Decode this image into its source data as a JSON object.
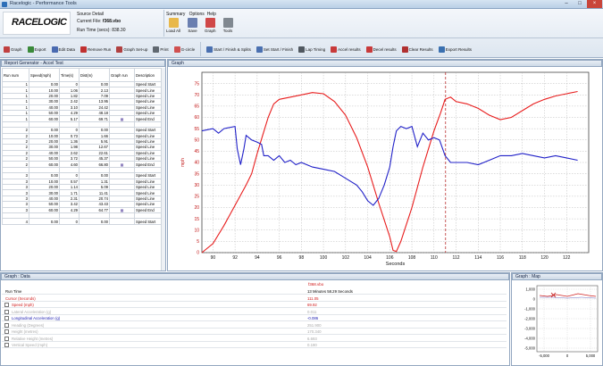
{
  "window": {
    "title": "Racelogic - Performance Tools",
    "minimize": "–",
    "maximize": "□",
    "close": "×"
  },
  "logo": {
    "text": "RACELOGIC"
  },
  "source": {
    "title": "Source Detail",
    "file_label": "Current File:",
    "file_value": "f368.vbo",
    "run_label": "Run Time (secs):",
    "run_value": "838.30"
  },
  "menu": [
    "Summary",
    "Options",
    "Help"
  ],
  "big_buttons": [
    {
      "label": "Load All",
      "icon": "folder-icon",
      "color": "#e8b84a"
    },
    {
      "label": "Save",
      "icon": "save-icon",
      "color": "#6a7fb0"
    },
    {
      "label": "Graph",
      "icon": "graph-icon",
      "color": "#d04848"
    },
    {
      "label": "Tools",
      "icon": "tools-icon",
      "color": "#808890"
    }
  ],
  "toolbar_row1": [
    {
      "label": "Graph",
      "icon": "graph-small-icon",
      "color": "#c04040"
    },
    {
      "label": "Export",
      "icon": "export-icon",
      "color": "#3a8a3a"
    },
    {
      "label": "Edit Data",
      "icon": "edit-icon",
      "color": "#4a6ab0"
    },
    {
      "label": "Remove Run",
      "icon": "remove-icon",
      "color": "#c03030"
    },
    {
      "label": "Graph Set-up",
      "icon": "graph-setup-icon",
      "color": "#b04040"
    },
    {
      "label": "Print",
      "icon": "print-icon",
      "color": "#606870"
    },
    {
      "label": "G-circle",
      "icon": "g-circle-icon",
      "color": "#d05050"
    }
  ],
  "toolbar_row2": [
    {
      "label": "Start / Finish & Splits",
      "icon": "splits-icon",
      "color": "#4a70b0"
    },
    {
      "label": "Set Start / Finish",
      "icon": "set-start-icon",
      "color": "#4a70b0"
    },
    {
      "label": "Lap Timing",
      "icon": "lap-timing-icon",
      "color": "#505860"
    },
    {
      "label": "Accel results",
      "icon": "accel-icon",
      "color": "#c83a3a"
    },
    {
      "label": "Decel results",
      "icon": "decel-icon",
      "color": "#c83a3a"
    },
    {
      "label": "Clear Results",
      "icon": "clear-results-icon",
      "color": "#b03030"
    },
    {
      "label": "Export Results",
      "icon": "export-results-icon",
      "color": "#3a70b0"
    }
  ],
  "report": {
    "title": "Report Generator - Accel Test",
    "headers": [
      "Run num",
      "Speed(mph)",
      "Time(s)",
      "Dist(m)",
      "Graph run",
      "Description"
    ],
    "rows": [
      [
        "1",
        "0.00",
        "0",
        "0.00",
        "",
        "Speed Start"
      ],
      [
        "1",
        "10.00",
        "1.06",
        "2.13",
        "",
        "Speed Line"
      ],
      [
        "1",
        "20.00",
        "1.82",
        "7.09",
        "",
        "Speed Line"
      ],
      [
        "1",
        "30.00",
        "2.42",
        "13.95",
        "",
        "Speed Line"
      ],
      [
        "1",
        "40.00",
        "3.10",
        "24.42",
        "",
        "Speed Line"
      ],
      [
        "1",
        "50.00",
        "4.29",
        "48.18",
        "",
        "Speed Line"
      ],
      [
        "1",
        "60.00",
        "5.17",
        "69.71",
        "icon",
        "Speed End"
      ],
      [
        "",
        "",
        "",
        "",
        "",
        ""
      ],
      [
        "2",
        "0.00",
        "0",
        "0.00",
        "",
        "Speed Start"
      ],
      [
        "2",
        "10.00",
        "0.73",
        "1.66",
        "",
        "Speed Line"
      ],
      [
        "2",
        "20.00",
        "1.36",
        "5.91",
        "",
        "Speed Line"
      ],
      [
        "2",
        "30.00",
        "1.98",
        "12.67",
        "",
        "Speed Line"
      ],
      [
        "2",
        "40.00",
        "2.62",
        "22.61",
        "",
        "Speed Line"
      ],
      [
        "2",
        "50.00",
        "3.72",
        "45.37",
        "",
        "Speed Line"
      ],
      [
        "2",
        "60.00",
        "4.60",
        "66.80",
        "icon",
        "Speed End"
      ],
      [
        "",
        "",
        "",
        "",
        "",
        ""
      ],
      [
        "3",
        "0.00",
        "0",
        "0.00",
        "",
        "Speed Start"
      ],
      [
        "3",
        "10.00",
        "0.57",
        "1.31",
        "",
        "Speed Line"
      ],
      [
        "3",
        "20.00",
        "1.14",
        "5.09",
        "",
        "Speed Line"
      ],
      [
        "3",
        "30.00",
        "1.71",
        "11.41",
        "",
        "Speed Line"
      ],
      [
        "3",
        "40.00",
        "2.31",
        "20.74",
        "",
        "Speed Line"
      ],
      [
        "3",
        "50.00",
        "3.42",
        "43.43",
        "",
        "Speed Line"
      ],
      [
        "3",
        "60.00",
        "4.29",
        "64.77",
        "icon",
        "Speed End"
      ],
      [
        "",
        "",
        "",
        "",
        "",
        ""
      ],
      [
        "4",
        "0.00",
        "0",
        "0.00",
        "",
        "Speed Start"
      ]
    ]
  },
  "graph": {
    "title": "Graph"
  },
  "chart_data": {
    "type": "line",
    "xlabel": "Seconds",
    "ylabel": "mph",
    "xlim": [
      89,
      124
    ],
    "ylim": [
      0,
      80
    ],
    "xticks": [
      90,
      92,
      94,
      96,
      98,
      100,
      102,
      104,
      106,
      108,
      110,
      112,
      114,
      116,
      118,
      120,
      122
    ],
    "yticks": [
      0,
      5,
      10,
      15,
      20,
      25,
      30,
      35,
      40,
      45,
      50,
      55,
      60,
      65,
      70,
      75
    ],
    "cursor_x": 111.05,
    "grid": true,
    "series": [
      {
        "color": "#e81c1c",
        "points": [
          [
            89,
            0
          ],
          [
            90,
            4
          ],
          [
            91,
            12
          ],
          [
            92,
            21
          ],
          [
            93,
            30
          ],
          [
            93.5,
            35
          ],
          [
            94,
            44
          ],
          [
            94.5,
            52
          ],
          [
            95,
            60
          ],
          [
            95.5,
            66
          ],
          [
            96,
            68
          ],
          [
            97,
            69
          ],
          [
            98,
            70
          ],
          [
            99,
            71
          ],
          [
            100,
            70.5
          ],
          [
            101,
            67
          ],
          [
            102,
            61
          ],
          [
            103,
            51
          ],
          [
            104,
            38
          ],
          [
            105,
            22
          ],
          [
            106,
            7
          ],
          [
            106.3,
            1
          ],
          [
            106.6,
            0.5
          ],
          [
            107,
            5
          ],
          [
            108,
            20
          ],
          [
            109,
            38
          ],
          [
            110,
            54
          ],
          [
            110.6,
            62
          ],
          [
            111,
            68
          ],
          [
            111.5,
            69
          ],
          [
            112,
            67
          ],
          [
            113,
            66
          ],
          [
            114,
            64
          ],
          [
            115,
            61
          ],
          [
            116,
            59
          ],
          [
            117,
            60
          ],
          [
            118,
            63
          ],
          [
            119,
            66
          ],
          [
            120,
            68
          ],
          [
            121,
            69.5
          ],
          [
            122,
            70.5
          ],
          [
            123,
            71.5
          ]
        ]
      },
      {
        "color": "#2020c8",
        "points": [
          [
            89,
            54
          ],
          [
            90,
            55
          ],
          [
            90.5,
            53
          ],
          [
            91,
            55
          ],
          [
            92,
            56
          ],
          [
            92.2,
            46
          ],
          [
            92.5,
            39
          ],
          [
            92.8,
            46
          ],
          [
            93,
            52
          ],
          [
            93.5,
            50
          ],
          [
            94,
            49
          ],
          [
            94.4,
            48
          ],
          [
            94.6,
            43
          ],
          [
            95,
            43
          ],
          [
            95.5,
            41
          ],
          [
            96,
            43
          ],
          [
            96.5,
            40
          ],
          [
            97,
            41
          ],
          [
            97.5,
            39
          ],
          [
            98,
            40
          ],
          [
            99,
            38
          ],
          [
            100,
            37
          ],
          [
            101,
            36
          ],
          [
            102,
            33
          ],
          [
            103,
            30
          ],
          [
            103.5,
            27
          ],
          [
            104,
            23
          ],
          [
            104.5,
            21
          ],
          [
            105,
            24
          ],
          [
            105.5,
            30
          ],
          [
            106,
            38
          ],
          [
            106.3,
            47
          ],
          [
            106.6,
            54
          ],
          [
            107,
            56
          ],
          [
            107.5,
            55
          ],
          [
            108,
            56
          ],
          [
            108.5,
            47
          ],
          [
            109,
            53
          ],
          [
            109.5,
            50
          ],
          [
            110,
            51
          ],
          [
            110.5,
            50
          ],
          [
            111,
            43
          ],
          [
            111.5,
            40
          ],
          [
            112,
            40
          ],
          [
            113,
            40
          ],
          [
            114,
            39
          ],
          [
            115,
            41
          ],
          [
            116,
            43
          ],
          [
            117,
            43
          ],
          [
            118,
            44
          ],
          [
            119,
            43
          ],
          [
            120,
            42
          ],
          [
            121,
            43
          ],
          [
            122,
            42
          ],
          [
            123,
            41
          ]
        ]
      }
    ]
  },
  "graph_data": {
    "title": "Graph : Data",
    "file": "f368.vbo",
    "rows": [
      {
        "label": "Run Time",
        "value": "13 Minutes 58.29 Seconds",
        "style": "normal",
        "check": false
      },
      {
        "label": "Cursor (Seconds)",
        "value": "111.05",
        "style": "red",
        "check": false
      },
      {
        "label": "Speed (mph)",
        "value": "69.92",
        "style": "red",
        "check": true
      },
      {
        "label": "Lateral Acceleration (g)",
        "value": "0.011",
        "style": "gray",
        "check": true
      },
      {
        "label": "Longitudinal Acceleration (g)",
        "value": "-0.086",
        "style": "blue",
        "check": true
      },
      {
        "label": "Heading (Degrees)",
        "value": "251.900",
        "style": "gray",
        "check": true
      },
      {
        "label": "Height (metres)",
        "value": "170.340",
        "style": "gray",
        "check": true
      },
      {
        "label": "Relative Height (metres)",
        "value": "6.693",
        "style": "gray",
        "check": true
      },
      {
        "label": "Vertical Speed (mph)",
        "value": "0.190",
        "style": "gray",
        "check": true
      }
    ]
  },
  "map": {
    "title": "Graph : Map",
    "xticks": [
      "-5,000",
      "0",
      "5,000"
    ],
    "yticks": [
      "1,000",
      "0",
      "-1,000",
      "-2,000",
      "-3,000",
      "-4,000",
      "-5,000"
    ]
  }
}
